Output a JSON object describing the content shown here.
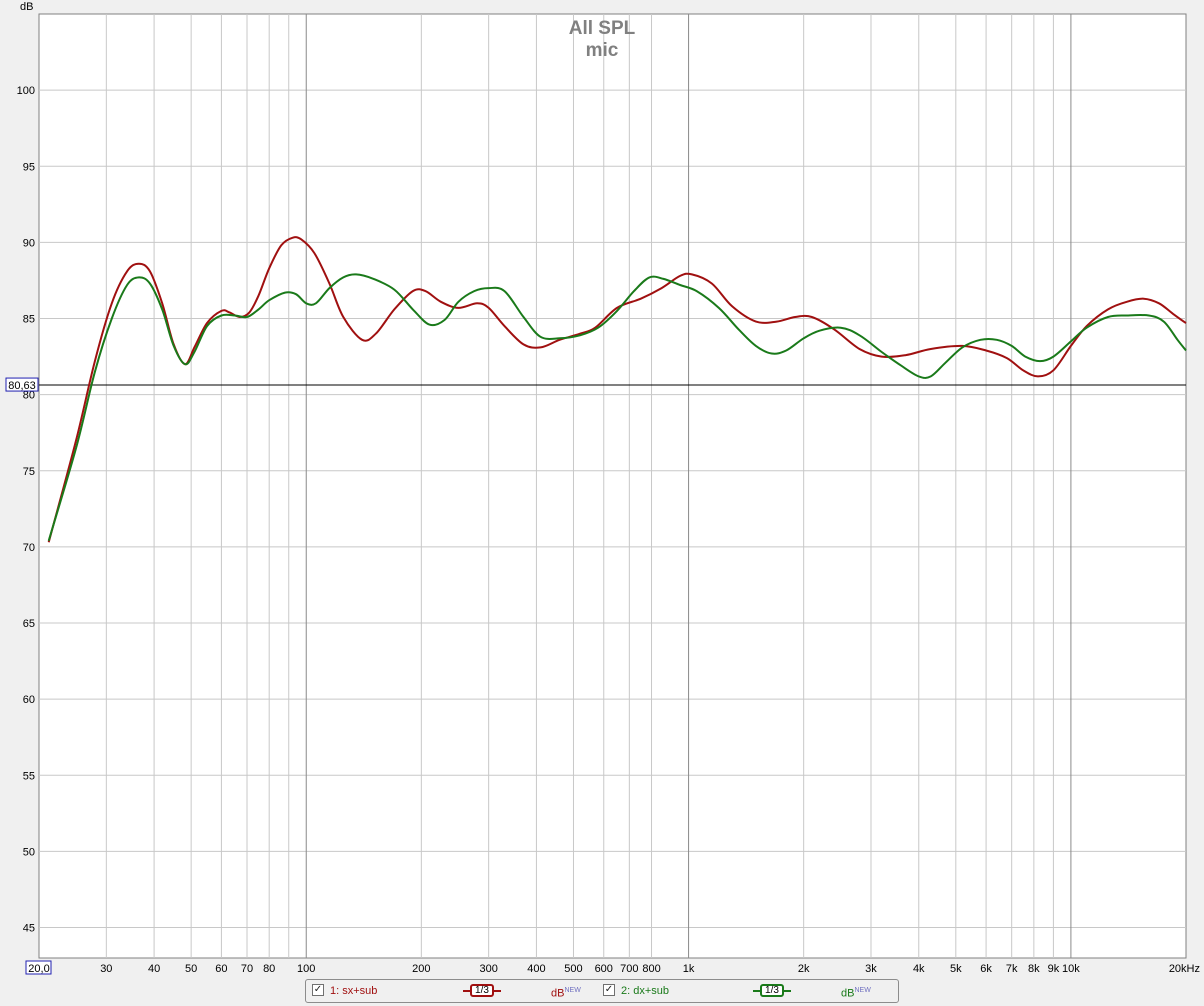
{
  "chart_data": {
    "type": "line",
    "title": "All SPL",
    "subtitle": "mic",
    "ylabel": "dB",
    "x_scale": "log",
    "xlim": [
      20,
      20000
    ],
    "ylim": [
      43,
      105
    ],
    "y_ticks": [
      45,
      50,
      55,
      60,
      65,
      70,
      75,
      80,
      85,
      90,
      95,
      100
    ],
    "x_ticks": [
      {
        "v": 20,
        "label": "20,0"
      },
      {
        "v": 30,
        "label": "30"
      },
      {
        "v": 40,
        "label": "40"
      },
      {
        "v": 50,
        "label": "50"
      },
      {
        "v": 60,
        "label": "60"
      },
      {
        "v": 70,
        "label": "70"
      },
      {
        "v": 80,
        "label": "80"
      },
      {
        "v": 100,
        "label": "100"
      },
      {
        "v": 200,
        "label": "200"
      },
      {
        "v": 300,
        "label": "300"
      },
      {
        "v": 400,
        "label": "400"
      },
      {
        "v": 500,
        "label": "500"
      },
      {
        "v": 600,
        "label": "600"
      },
      {
        "v": 700,
        "label": "700"
      },
      {
        "v": 800,
        "label": "800"
      },
      {
        "v": 1000,
        "label": "1k"
      },
      {
        "v": 2000,
        "label": "2k"
      },
      {
        "v": 3000,
        "label": "3k"
      },
      {
        "v": 4000,
        "label": "4k"
      },
      {
        "v": 5000,
        "label": "5k"
      },
      {
        "v": 6000,
        "label": "6k"
      },
      {
        "v": 7000,
        "label": "7k"
      },
      {
        "v": 8000,
        "label": "8k"
      },
      {
        "v": 9000,
        "label": "9k"
      },
      {
        "v": 10000,
        "label": "10k"
      },
      {
        "v": 20000,
        "label": "20kHz"
      }
    ],
    "minor_x_grid": [
      90
    ],
    "major_x_grid": [
      100,
      1000,
      10000
    ],
    "grid": true,
    "reference_line": {
      "value": 80.63,
      "label": "80,63"
    },
    "series": [
      {
        "name": "1: sx+sub",
        "color": "#a01010",
        "points": [
          [
            21.2,
            70.3
          ],
          [
            25,
            77
          ],
          [
            28,
            82.2
          ],
          [
            31,
            86
          ],
          [
            34,
            88.1
          ],
          [
            36.5,
            88.6
          ],
          [
            39,
            88.1
          ],
          [
            42,
            86
          ],
          [
            45,
            83.3
          ],
          [
            48.2,
            82
          ],
          [
            51,
            83.1
          ],
          [
            55,
            84.7
          ],
          [
            60,
            85.5
          ],
          [
            63,
            85.4
          ],
          [
            67,
            85.1
          ],
          [
            71,
            85.4
          ],
          [
            75,
            86.5
          ],
          [
            80,
            88.3
          ],
          [
            86,
            89.8
          ],
          [
            92,
            90.3
          ],
          [
            97,
            90.2
          ],
          [
            105,
            89.3
          ],
          [
            115,
            87.3
          ],
          [
            125,
            85.1
          ],
          [
            140,
            83.6
          ],
          [
            152,
            84
          ],
          [
            170,
            85.6
          ],
          [
            190,
            86.8
          ],
          [
            205,
            86.8
          ],
          [
            225,
            86.1
          ],
          [
            250,
            85.7
          ],
          [
            280,
            86
          ],
          [
            300,
            85.7
          ],
          [
            330,
            84.5
          ],
          [
            370,
            83.3
          ],
          [
            410,
            83.1
          ],
          [
            460,
            83.6
          ],
          [
            520,
            84
          ],
          [
            570,
            84.4
          ],
          [
            650,
            85.7
          ],
          [
            750,
            86.3
          ],
          [
            850,
            87
          ],
          [
            950,
            87.8
          ],
          [
            1020,
            87.9
          ],
          [
            1150,
            87.3
          ],
          [
            1300,
            85.8
          ],
          [
            1500,
            84.8
          ],
          [
            1700,
            84.8
          ],
          [
            1900,
            85.1
          ],
          [
            2100,
            85.1
          ],
          [
            2400,
            84.3
          ],
          [
            2800,
            83
          ],
          [
            3200,
            82.5
          ],
          [
            3700,
            82.6
          ],
          [
            4300,
            83
          ],
          [
            5200,
            83.2
          ],
          [
            6000,
            82.9
          ],
          [
            6800,
            82.4
          ],
          [
            7500,
            81.6
          ],
          [
            8200,
            81.2
          ],
          [
            9000,
            81.6
          ],
          [
            10000,
            83.2
          ],
          [
            11000,
            84.5
          ],
          [
            12500,
            85.6
          ],
          [
            14000,
            86.1
          ],
          [
            15500,
            86.3
          ],
          [
            17000,
            86
          ],
          [
            18500,
            85.3
          ],
          [
            20000,
            84.7
          ]
        ]
      },
      {
        "name": "2: dx+sub",
        "color": "#1a7a1a",
        "points": [
          [
            21.2,
            70.4
          ],
          [
            25,
            76.5
          ],
          [
            28,
            81.5
          ],
          [
            31,
            85
          ],
          [
            34,
            87.2
          ],
          [
            36.5,
            87.7
          ],
          [
            39,
            87.3
          ],
          [
            42,
            85.6
          ],
          [
            45,
            83.2
          ],
          [
            48.2,
            82
          ],
          [
            51,
            82.8
          ],
          [
            55,
            84.5
          ],
          [
            60,
            85.2
          ],
          [
            65,
            85.2
          ],
          [
            70,
            85.1
          ],
          [
            75,
            85.6
          ],
          [
            80,
            86.2
          ],
          [
            88,
            86.7
          ],
          [
            94,
            86.6
          ],
          [
            100,
            86
          ],
          [
            106,
            86
          ],
          [
            115,
            87
          ],
          [
            125,
            87.7
          ],
          [
            135,
            87.9
          ],
          [
            150,
            87.6
          ],
          [
            170,
            86.9
          ],
          [
            190,
            85.6
          ],
          [
            210,
            84.6
          ],
          [
            230,
            84.9
          ],
          [
            250,
            86.1
          ],
          [
            275,
            86.8
          ],
          [
            300,
            87
          ],
          [
            330,
            86.8
          ],
          [
            370,
            85.1
          ],
          [
            410,
            83.8
          ],
          [
            460,
            83.7
          ],
          [
            520,
            83.9
          ],
          [
            580,
            84.4
          ],
          [
            650,
            85.5
          ],
          [
            720,
            86.8
          ],
          [
            790,
            87.7
          ],
          [
            860,
            87.6
          ],
          [
            950,
            87.2
          ],
          [
            1050,
            86.8
          ],
          [
            1200,
            85.7
          ],
          [
            1350,
            84.3
          ],
          [
            1500,
            83.2
          ],
          [
            1650,
            82.7
          ],
          [
            1800,
            82.9
          ],
          [
            2000,
            83.7
          ],
          [
            2200,
            84.2
          ],
          [
            2500,
            84.4
          ],
          [
            2800,
            83.9
          ],
          [
            3200,
            82.8
          ],
          [
            3600,
            81.9
          ],
          [
            4000,
            81.2
          ],
          [
            4300,
            81.2
          ],
          [
            4700,
            82.1
          ],
          [
            5200,
            83.1
          ],
          [
            5800,
            83.6
          ],
          [
            6400,
            83.6
          ],
          [
            7000,
            83.2
          ],
          [
            7600,
            82.5
          ],
          [
            8300,
            82.2
          ],
          [
            9000,
            82.5
          ],
          [
            10000,
            83.5
          ],
          [
            11000,
            84.4
          ],
          [
            12500,
            85.1
          ],
          [
            14000,
            85.2
          ],
          [
            16000,
            85.2
          ],
          [
            17500,
            84.8
          ],
          [
            19000,
            83.6
          ],
          [
            20000,
            82.9
          ]
        ]
      }
    ]
  },
  "legend": [
    {
      "check": "✓",
      "name": "1: sx+sub",
      "smoothing": "1/3",
      "unit": "dB",
      "unit_sup": "NEW",
      "color": "#a01010"
    },
    {
      "check": "✓",
      "name": "2: dx+sub",
      "smoothing": "1/3",
      "unit": "dB",
      "unit_sup": "NEW",
      "color": "#1a7a1a"
    }
  ]
}
